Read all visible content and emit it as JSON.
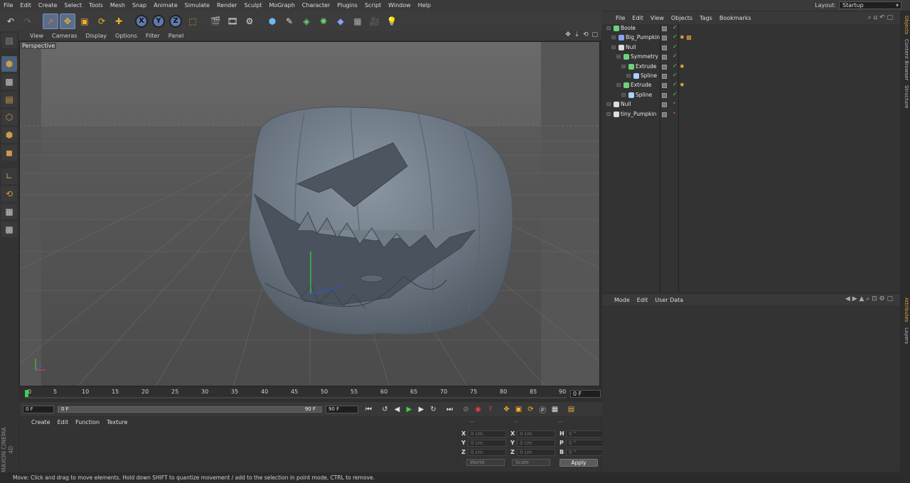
{
  "menubar": {
    "items": [
      "File",
      "Edit",
      "Create",
      "Select",
      "Tools",
      "Mesh",
      "Snap",
      "Animate",
      "Simulate",
      "Render",
      "Sculpt",
      "MoGraph",
      "Character",
      "Plugins",
      "Script",
      "Window",
      "Help"
    ],
    "layout_label": "Layout:",
    "layout_value": "Startup"
  },
  "toolbar": {
    "axis_x": "X",
    "axis_y": "Y",
    "axis_z": "Z"
  },
  "viewport": {
    "menu": [
      "View",
      "Cameras",
      "Display",
      "Options",
      "Filter",
      "Panel"
    ],
    "label": "Perspective"
  },
  "timeline": {
    "ticks": [
      "0",
      "5",
      "10",
      "15",
      "20",
      "25",
      "30",
      "35",
      "40",
      "45",
      "50",
      "55",
      "60",
      "65",
      "70",
      "75",
      "80",
      "85",
      "90"
    ],
    "current_frame": "0 F"
  },
  "playbar": {
    "start": "0 F",
    "range_start": "0 F",
    "range_end": "90 F",
    "end": "90 F"
  },
  "material_manager": {
    "menu": [
      "Create",
      "Edit",
      "Function",
      "Texture"
    ]
  },
  "coordinates": {
    "header": [
      "--",
      "--",
      "--"
    ],
    "rows": [
      {
        "a_label": "X",
        "a_val": "0 cm",
        "b_label": "X",
        "b_val": "0 cm",
        "c_label": "H",
        "c_val": "0 °"
      },
      {
        "a_label": "Y",
        "a_val": "0 cm",
        "b_label": "Y",
        "b_val": "0 cm",
        "c_label": "P",
        "c_val": "0 °"
      },
      {
        "a_label": "Z",
        "a_val": "0 cm",
        "b_label": "Z",
        "b_val": "0 cm",
        "c_label": "B",
        "c_val": "0 °"
      }
    ],
    "mode1": "World",
    "mode2": "Scale",
    "apply": "Apply"
  },
  "object_manager": {
    "menu": [
      "File",
      "Edit",
      "View",
      "Objects",
      "Tags",
      "Bookmarks"
    ],
    "objects": [
      {
        "name": "Boole",
        "indent": 0,
        "status": "check",
        "tags": ""
      },
      {
        "name": "Big_Pumpkin",
        "indent": 1,
        "status": "check",
        "tags": "✸ ▩"
      },
      {
        "name": "Null",
        "indent": 1,
        "status": "check",
        "tags": ""
      },
      {
        "name": "Symmetry",
        "indent": 2,
        "status": "check",
        "tags": ""
      },
      {
        "name": "Extrude",
        "indent": 3,
        "status": "check",
        "tags": "✸"
      },
      {
        "name": "Spline",
        "indent": 4,
        "status": "check",
        "tags": ""
      },
      {
        "name": "Extrude",
        "indent": 2,
        "status": "check",
        "tags": "✸"
      },
      {
        "name": "Spline",
        "indent": 3,
        "status": "check",
        "tags": ""
      },
      {
        "name": "Null",
        "indent": 0,
        "status": "x",
        "tags": ""
      },
      {
        "name": "tiny_Pumpkin",
        "indent": 0,
        "status": "x",
        "tags": ""
      }
    ]
  },
  "attribute_manager": {
    "menu": [
      "Mode",
      "Edit",
      "User Data"
    ]
  },
  "side_tabs": {
    "top": [
      "Objects",
      "Content Browser",
      "Structure"
    ],
    "bottom": [
      "Attributes",
      "Layers"
    ]
  },
  "statusbar": {
    "text": "Move: Click and drag to move elements. Hold down SHIFT to quantize movement / add to the selection in point mode, CTRL to remove."
  },
  "branding": {
    "logo": "MAXON CINEMA 4D"
  }
}
